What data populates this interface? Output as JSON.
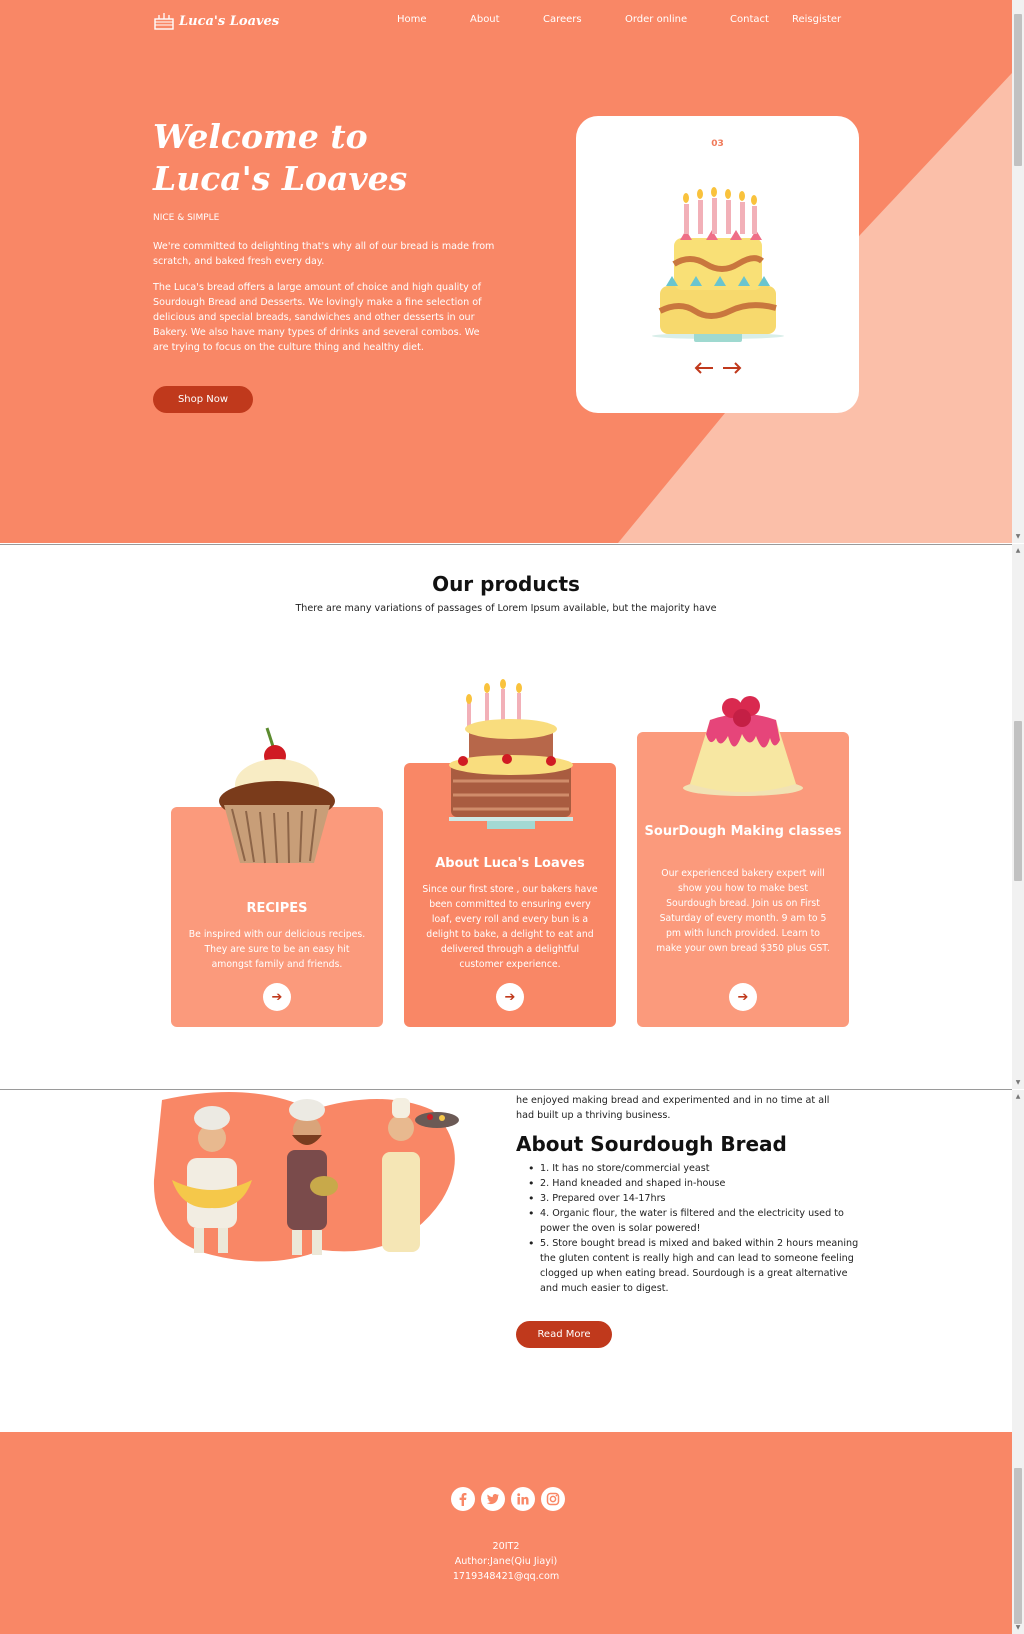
{
  "brand": {
    "logo_text": "Luca's Loaves"
  },
  "nav": {
    "items": [
      {
        "label": "Home"
      },
      {
        "label": "About"
      },
      {
        "label": "Careers"
      },
      {
        "label": "Order online"
      },
      {
        "label": "Contact"
      },
      {
        "label": "Reisgister"
      }
    ]
  },
  "hero": {
    "title_line1": "Welcome to",
    "title_line2": "Luca's Loaves",
    "tagline": "NICE & SIMPLE",
    "paragraph1": "We're committed to delighting that's why all of our bread is made from scratch, and baked fresh every day.",
    "paragraph2": "The Luca's bread offers a large amount of choice and high quality of Sourdough Bread and Desserts. We lovingly make a fine selection of delicious and special breads, sandwiches and other desserts in our Bakery. We also have many types of drinks and several combos. We are trying to focus on the culture thing and healthy diet.",
    "cta_label": "Shop Now",
    "slider": {
      "index": "03",
      "image_icon": "birthday-cake-icon",
      "prev_icon": "arrow-left-icon",
      "next_icon": "arrow-right-icon"
    }
  },
  "products": {
    "title": "Our products",
    "subtitle": "There are many variations of passages of Lorem Ipsum available, but the majority have",
    "cards": [
      {
        "title": "RECIPES",
        "text": "Be inspired with our delicious recipes. They are sure to be an easy hit amongst family and friends.",
        "image_icon": "cupcake-icon",
        "button_icon": "arrow-right-icon"
      },
      {
        "title": "About Luca's Loaves",
        "text": "Since our first store , our bakers have been committed to ensuring every loaf, every roll and every bun is a delight to bake, a delight to eat and delivered through a delightful customer experience.",
        "image_icon": "layer-cake-icon",
        "button_icon": "arrow-right-icon"
      },
      {
        "title": "SourDough Making classes",
        "text": "Our experienced bakery expert will show you how to make best Sourdough bread. Join us on First Saturday of every month. 9 am to 5 pm with lunch provided. Learn to make your own bread $350 plus GST.",
        "image_icon": "pudding-icon",
        "button_icon": "arrow-right-icon"
      }
    ]
  },
  "about": {
    "intro": "he enjoyed making bread and experimented and in no time at all had built up a thriving business.",
    "title": "About Sourdough Bread",
    "list": [
      "1. It has no store/commercial yeast",
      "2. Hand kneaded and shaped in-house",
      "3. Prepared over 14-17hrs",
      "4. Organic flour, the water is filtered and the electricity used to power the oven is solar powered!",
      "5. Store bought bread is mixed and baked within 2 hours meaning the gluten content is really high and can lead to someone feeling clogged up when eating bread. Sourdough is a great alternative and much easier to digest."
    ],
    "button_label": "Read More",
    "image_icon": "chefs-illustration-icon"
  },
  "footer": {
    "socials": [
      "facebook-icon",
      "twitter-icon",
      "linkedin-icon",
      "instagram-icon"
    ],
    "line1": "20IT2",
    "line2": "Author:Jane(Qiu Jiayi)",
    "line3": "1719348421@qq.com"
  },
  "colors": {
    "primary": "#f98766",
    "card_light": "#fb9a7c",
    "accent_dark": "#c0391c",
    "diagonal": "#fbbfa9"
  }
}
